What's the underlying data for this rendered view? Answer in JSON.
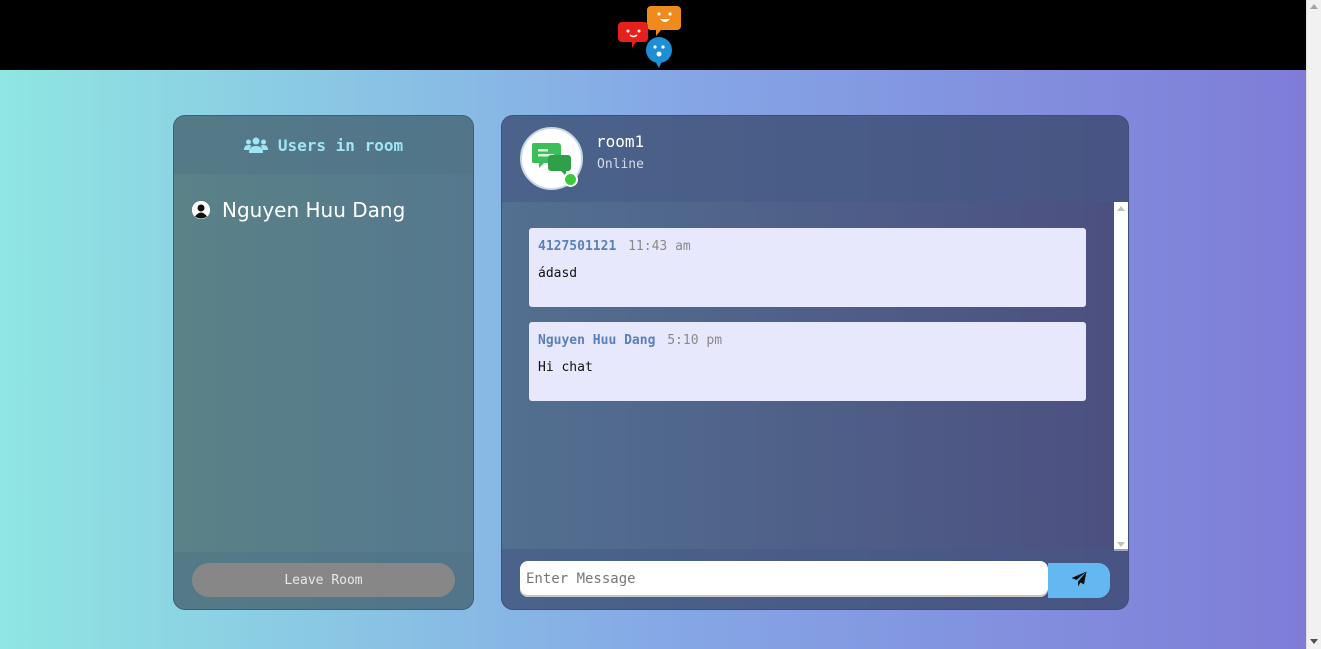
{
  "users_panel": {
    "title": "Users in room",
    "users": [
      {
        "name": "Nguyen Huu Dang"
      }
    ],
    "leave_label": "Leave Room"
  },
  "chat": {
    "room_name": "room1",
    "status": "Online",
    "messages": [
      {
        "author": "4127501121",
        "time": "11:43 am",
        "text": "ádasd"
      },
      {
        "author": "Nguyen Huu Dang",
        "time": "5:10 pm",
        "text": "Hi chat"
      }
    ],
    "input_placeholder": "Enter Message"
  },
  "colors": {
    "header_accent": "#9ee6f5",
    "author": "#5b7fb8",
    "online": "#3ec83e",
    "send_button": "#64b8f2"
  },
  "icons": {
    "logo": "chat-bubbles-logo-icon",
    "users_header": "users-group-icon",
    "user_avatar": "user-avatar-icon",
    "room": "chat-room-icon",
    "send": "paper-plane-icon"
  }
}
